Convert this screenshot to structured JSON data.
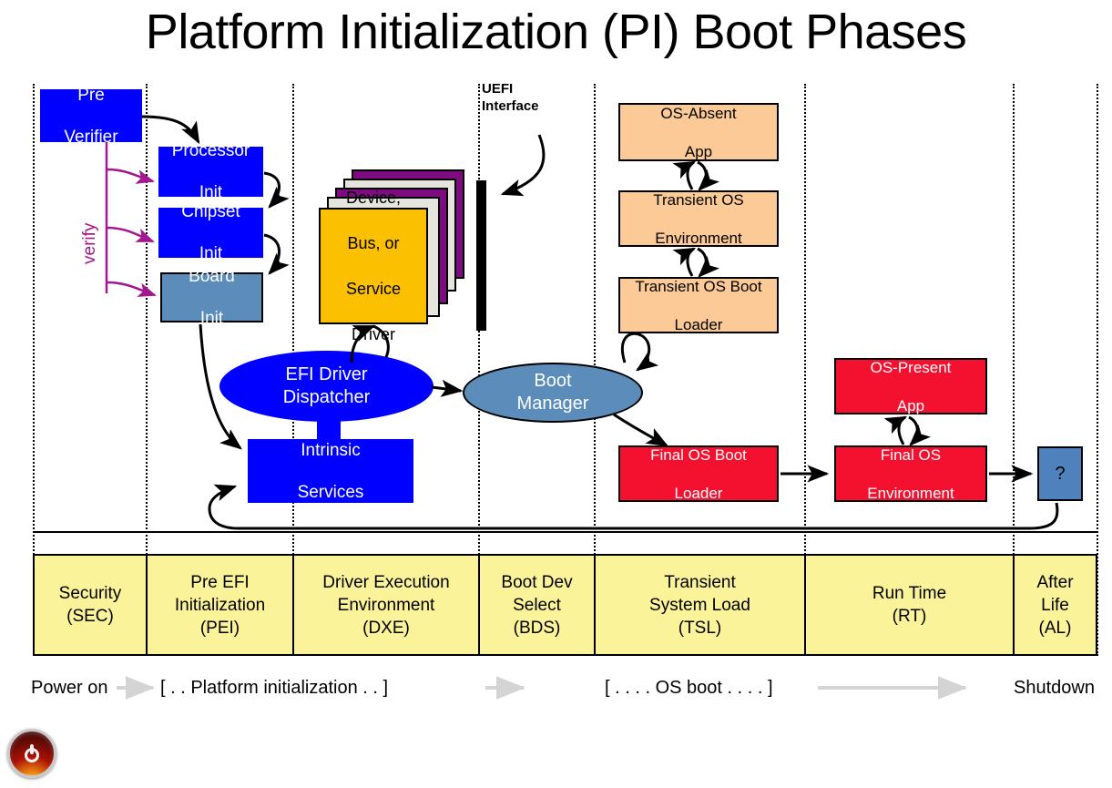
{
  "title": "Platform Initialization (PI) Boot Phases",
  "annotations": {
    "uefi_interface": "UEFI\nInterface",
    "uefi_interface_line1": "UEFI",
    "uefi_interface_line2": "Interface",
    "verify": "verify"
  },
  "nodes": {
    "pre_verifier": {
      "line1": "Pre",
      "line2": "Verifier",
      "color": "#0000FE",
      "text_color": "#FFFFFF"
    },
    "processor_init": {
      "line1": "Processor",
      "line2": "Init",
      "color": "#0000FE",
      "text_color": "#FFFFFF"
    },
    "chipset_init": {
      "line1": "Chipset",
      "line2": "Init",
      "color": "#0000FE",
      "text_color": "#FFFFFF"
    },
    "board_init": {
      "line1": "Board",
      "line2": "Init",
      "color": "#5B8CBA",
      "text_color": "#FFFFFF"
    },
    "driver_card": {
      "line1": "Device,",
      "line2": "Bus, or",
      "line3": "Service",
      "line4": "Driver",
      "color": "#FBC000",
      "text_color": "#000000"
    },
    "efi_driver_dispatcher": {
      "line1": "EFI Driver",
      "line2": "Dispatcher",
      "color": "#0000FE",
      "text_color": "#FFFFFF"
    },
    "intrinsic_services": {
      "line1": "Intrinsic",
      "line2": "Services",
      "color": "#0000FE",
      "text_color": "#FFFFFF"
    },
    "boot_manager": {
      "line1": "Boot",
      "line2": "Manager",
      "color": "#5B8CBA",
      "text_color": "#FFFFFF"
    },
    "os_absent_app": {
      "line1": "OS-Absent",
      "line2": "App",
      "color": "#FBCA96",
      "text_color": "#000000"
    },
    "transient_os_environment": {
      "line1": "Transient OS",
      "line2": "Environment",
      "color": "#FBCA96",
      "text_color": "#000000"
    },
    "transient_os_boot_loader": {
      "line1": "Transient OS Boot",
      "line2": "Loader",
      "color": "#FBCA96",
      "text_color": "#000000"
    },
    "os_present_app": {
      "line1": "OS-Present",
      "line2": "App",
      "color": "#F4112F",
      "text_color": "#FFFFFF"
    },
    "final_os_boot_loader": {
      "line1": "Final OS Boot",
      "line2": "Loader",
      "color": "#F4112F",
      "text_color": "#FFFFFF"
    },
    "final_os_environment": {
      "line1": "Final OS",
      "line2": "Environment",
      "color": "#F4112F",
      "text_color": "#FFFFFF"
    },
    "after_life_unknown": {
      "line1": "?",
      "color": "#4F81BD",
      "text_color": "#000000"
    }
  },
  "phases": [
    {
      "line1": "Security",
      "line2": "(SEC)",
      "line3": "",
      "abbr": "SEC"
    },
    {
      "line1": "Pre EFI",
      "line2": "Initialization",
      "line3": "(PEI)",
      "abbr": "PEI"
    },
    {
      "line1": "Driver Execution",
      "line2": "Environment",
      "line3": "(DXE)",
      "abbr": "DXE"
    },
    {
      "line1": "Boot Dev",
      "line2": "Select",
      "line3": "(BDS)",
      "abbr": "BDS"
    },
    {
      "line1": "Transient",
      "line2": "System Load",
      "line3": "(TSL)",
      "abbr": "TSL"
    },
    {
      "line1": "Run Time",
      "line2": "(RT)",
      "line3": "",
      "abbr": "RT"
    },
    {
      "line1": "After",
      "line2": "Life",
      "line3": "(AL)",
      "abbr": "AL"
    }
  ],
  "timeline": {
    "power_on": "Power on",
    "platform_init": "[ . . Platform initialization . . ]",
    "os_boot": "[ . . . . OS boot . . . . ]",
    "shutdown": "Shutdown"
  },
  "icons": {
    "power_button": "power-button-icon"
  },
  "colors": {
    "blue": "#0000FE",
    "steel_blue": "#5B8CBA",
    "peach": "#FBCA96",
    "red": "#F4112F",
    "amber": "#FBC000",
    "purple": "#7D0C81",
    "cream": "#E6E5DD",
    "yellow_phase": "#FAF39A",
    "verify_magenta": "#A3178F",
    "black": "#000000",
    "white": "#FFFFFF"
  }
}
